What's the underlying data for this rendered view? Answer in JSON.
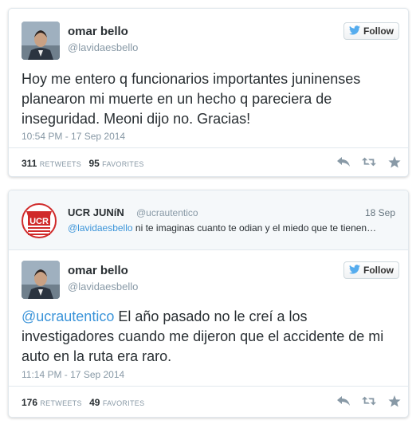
{
  "tweet1": {
    "user_name": "omar bello",
    "user_handle": "@lavidaesbello",
    "follow_label": "Follow",
    "text": "Hoy me entero q funcionarios importantes juninenses planearon mi muerte en un hecho q pareciera de inseguridad. Meoni dijo no. Gracias!",
    "timestamp": "10:54 PM - 17 Sep 2014",
    "retweets_count": "311",
    "retweets_label": "RETWEETS",
    "favorites_count": "95",
    "favorites_label": "FAVORITES"
  },
  "reply_context": {
    "user_name": "UCR JUNíN",
    "user_handle": "@ucrautentico",
    "date": "18 Sep",
    "mention": "@lavidaesbello",
    "text": " ni te imaginas cuanto te odian y el miedo que te tienen…",
    "logo_text": "UCR"
  },
  "tweet2": {
    "user_name": "omar bello",
    "user_handle": "@lavidaesbello",
    "follow_label": "Follow",
    "mention": "@ucrautentico",
    "text": " El año pasado no le creí a los investigadores cuando me dijeron que el accidente de mi auto en la ruta era raro.",
    "timestamp": "11:14 PM - 17 Sep 2014",
    "retweets_count": "176",
    "retweets_label": "RETWEETS",
    "favorites_count": "49",
    "favorites_label": "FAVORITES"
  },
  "colors": {
    "link": "#3b94d9",
    "bird": "#55acee",
    "muted": "#8899a6",
    "ucr_red": "#d02a2a"
  },
  "icons": [
    "twitter-bird-icon",
    "reply-icon",
    "retweet-icon",
    "favorite-star-icon"
  ]
}
